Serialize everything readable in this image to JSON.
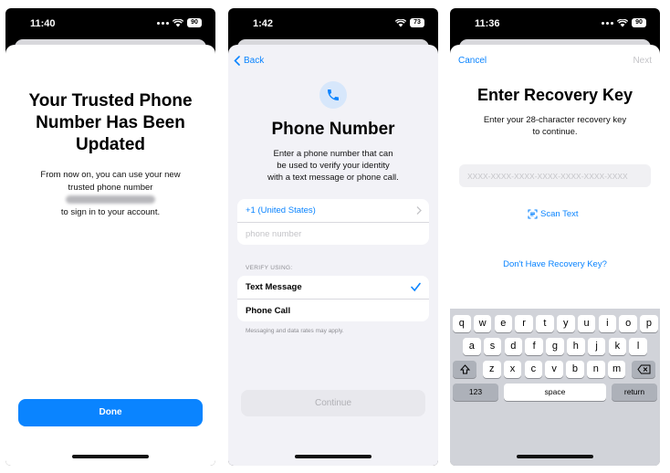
{
  "screen1": {
    "time": "11:40",
    "battery": "90",
    "title": "Your Trusted Phone Number Has Been Updated",
    "body_line1": "From now on, you can use your new",
    "body_line2": "trusted phone number",
    "body_line4": "to sign in to your account.",
    "done_label": "Done"
  },
  "screen2": {
    "time": "1:42",
    "battery": "73",
    "back_label": "Back",
    "title": "Phone Number",
    "desc_line1": "Enter a phone number that can",
    "desc_line2": "be used to verify your identity",
    "desc_line3": "with a text message or phone call.",
    "country_code": "+1 (United States)",
    "phone_placeholder": "phone number",
    "section_label": "VERIFY USING:",
    "option_text": "Text Message",
    "option_call": "Phone Call",
    "selected_option": "Text Message",
    "footnote": "Messaging and data rates may apply.",
    "continue_label": "Continue"
  },
  "screen3": {
    "time": "11:36",
    "battery": "90",
    "cancel_label": "Cancel",
    "next_label": "Next",
    "title": "Enter Recovery Key",
    "desc_line1": "Enter your 28-character recovery key",
    "desc_line2": "to continue.",
    "key_placeholder": "XXXX-XXXX-XXXX-XXXX-XXXX-XXXX-XXXX",
    "scan_label": "Scan Text",
    "no_key_link": "Don't Have Recovery Key?",
    "keyboard": {
      "row1": [
        "q",
        "w",
        "e",
        "r",
        "t",
        "y",
        "u",
        "i",
        "o",
        "p"
      ],
      "row2": [
        "a",
        "s",
        "d",
        "f",
        "g",
        "h",
        "j",
        "k",
        "l"
      ],
      "row3": [
        "z",
        "x",
        "c",
        "v",
        "b",
        "n",
        "m"
      ],
      "numbers_label": "123",
      "space_label": "space",
      "return_label": "return"
    }
  },
  "colors": {
    "accent": "#0a84ff",
    "keyboard_bg": "#d1d3d9",
    "disabled_button": "#e8e8ed"
  },
  "icons": [
    "wifi-icon",
    "battery-icon",
    "chevron-left-icon",
    "phone-icon",
    "chevron-right-icon",
    "checkmark-icon",
    "scan-text-icon",
    "shift-icon",
    "delete-icon",
    "emoji-icon",
    "microphone-icon"
  ]
}
